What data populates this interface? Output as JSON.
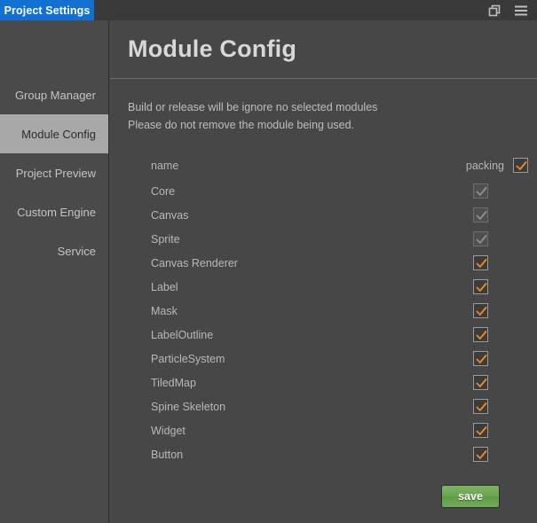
{
  "titlebar": {
    "tab_label": "Project Settings",
    "icons": [
      {
        "name": "restore-windows-icon",
        "label": "restore"
      },
      {
        "name": "hamburger-menu-icon",
        "label": "menu"
      }
    ]
  },
  "sidebar": {
    "items": [
      {
        "label": "Group Manager",
        "selected": false
      },
      {
        "label": "Module Config",
        "selected": true
      },
      {
        "label": "Project Preview",
        "selected": false
      },
      {
        "label": "Custom Engine",
        "selected": false
      },
      {
        "label": "Service",
        "selected": false
      }
    ]
  },
  "main": {
    "title": "Module Config",
    "description_line1": "Build or release will be ignore no selected modules",
    "description_line2": "Please do not remove the module being used.",
    "table": {
      "header": {
        "name_label": "name",
        "packing_label": "packing",
        "select_all_checked": true,
        "select_all_disabled": false
      },
      "rows": [
        {
          "name": "Core",
          "checked": true,
          "disabled": true
        },
        {
          "name": "Canvas",
          "checked": true,
          "disabled": true
        },
        {
          "name": "Sprite",
          "checked": true,
          "disabled": true
        },
        {
          "name": "Canvas Renderer",
          "checked": true,
          "disabled": false
        },
        {
          "name": "Label",
          "checked": true,
          "disabled": false
        },
        {
          "name": "Mask",
          "checked": true,
          "disabled": false
        },
        {
          "name": "LabelOutline",
          "checked": true,
          "disabled": false
        },
        {
          "name": "ParticleSystem",
          "checked": true,
          "disabled": false
        },
        {
          "name": "TiledMap",
          "checked": true,
          "disabled": false
        },
        {
          "name": "Spine Skeleton",
          "checked": true,
          "disabled": false
        },
        {
          "name": "Widget",
          "checked": true,
          "disabled": false
        },
        {
          "name": "Button",
          "checked": true,
          "disabled": false
        }
      ]
    },
    "save_label": "save"
  },
  "colors": {
    "accent_tab": "#1270d3",
    "checkbox_tick": "#f08a24",
    "save_button": "#6aa551",
    "background": "#474747",
    "sidebar": "#4a4a4a",
    "sidebar_selected": "#a8a8a8"
  }
}
